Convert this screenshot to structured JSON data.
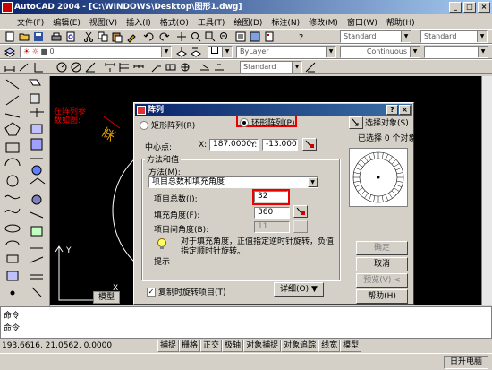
{
  "window": {
    "title": "AutoCAD 2004 - [C:\\WINDOWS\\Desktop\\图形1.dwg]",
    "min": "_",
    "max": "□",
    "close": "×"
  },
  "menu": [
    "文件(F)",
    "编辑(E)",
    "视图(V)",
    "插入(I)",
    "格式(O)",
    "工具(T)",
    "绘图(D)",
    "标注(N)",
    "修改(M)",
    "窗口(W)",
    "帮助(H)"
  ],
  "toolbar": {
    "layer_value": "0",
    "style1": "Standard",
    "style2": "Standard",
    "color": "ByLayer",
    "linetype": "Continuous",
    "plotstyle": "Standard"
  },
  "canvas": {
    "annotation": "在阵列参数如图:",
    "tab_model": "模型",
    "y_label": "Y",
    "x_label": "X",
    "background": "#000000",
    "accent": "#e00000"
  },
  "dialog": {
    "title": "阵列",
    "help": "?",
    "close": "×",
    "rect_label": "矩形阵列(R)",
    "polar_label": "环形阵列(P)",
    "select_objects": "选择对象(S)",
    "selected_count": "已选择 0 个对象",
    "center_label": "中心点:",
    "x_label": "X:",
    "x_value": "187.0000",
    "y_label": "Y:",
    "y_value": "-13.0000",
    "method_group": "方法和值",
    "method_label": "方法(M):",
    "method_value": "项目总数和填充角度",
    "items_label": "项目总数(I):",
    "items_value": "32",
    "fill_label": "填充角度(F):",
    "fill_value": "360",
    "between_label": "项目间角度(B):",
    "between_value": "11",
    "tip_text": "对于填充角度，正值指定逆时针旋转，负值指定顺时针旋转。",
    "tip_label": "提示",
    "rotate_label": "复制时旋转项目(T)",
    "rotate_checked": true,
    "details_btn": "详细(O)",
    "ok_btn": "确定",
    "cancel_btn": "取消",
    "preview_btn": "预览(V) <",
    "help_btn": "帮助(H)"
  },
  "command": {
    "line1": "命令:",
    "line2": "命令:"
  },
  "status": {
    "coords": "193.6616, 21.0562, 0.0000",
    "buttons": [
      "捕捉",
      "栅格",
      "正交",
      "极轴",
      "对象捕捉",
      "对象追踪",
      "线宽",
      "模型"
    ]
  },
  "taskbar": {
    "item": "日升电脑"
  }
}
